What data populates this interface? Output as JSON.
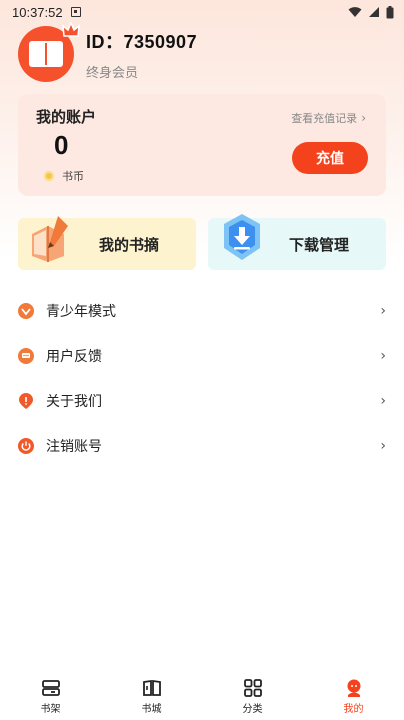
{
  "status_bar": {
    "time": "10:37:52"
  },
  "profile": {
    "id_text": "ID：7350907",
    "membership": "终身会员"
  },
  "account": {
    "title": "我的账户",
    "balance": "0",
    "unit": "书币",
    "recharge_history": "查看充值记录",
    "recharge_button": "充值"
  },
  "features": [
    {
      "label": "我的书摘"
    },
    {
      "label": "下载管理"
    }
  ],
  "menu": [
    {
      "label": "青少年模式",
      "color": "#f07a3a"
    },
    {
      "label": "用户反馈",
      "color": "#f07a3a"
    },
    {
      "label": "关于我们",
      "color": "#f05a2a"
    },
    {
      "label": "注销账号",
      "color": "#f05a2a"
    }
  ],
  "tabs": [
    {
      "label": "书架"
    },
    {
      "label": "书城"
    },
    {
      "label": "分类"
    },
    {
      "label": "我的"
    }
  ],
  "colors": {
    "accent": "#f4431c",
    "card_bg": "#fde8e2"
  }
}
